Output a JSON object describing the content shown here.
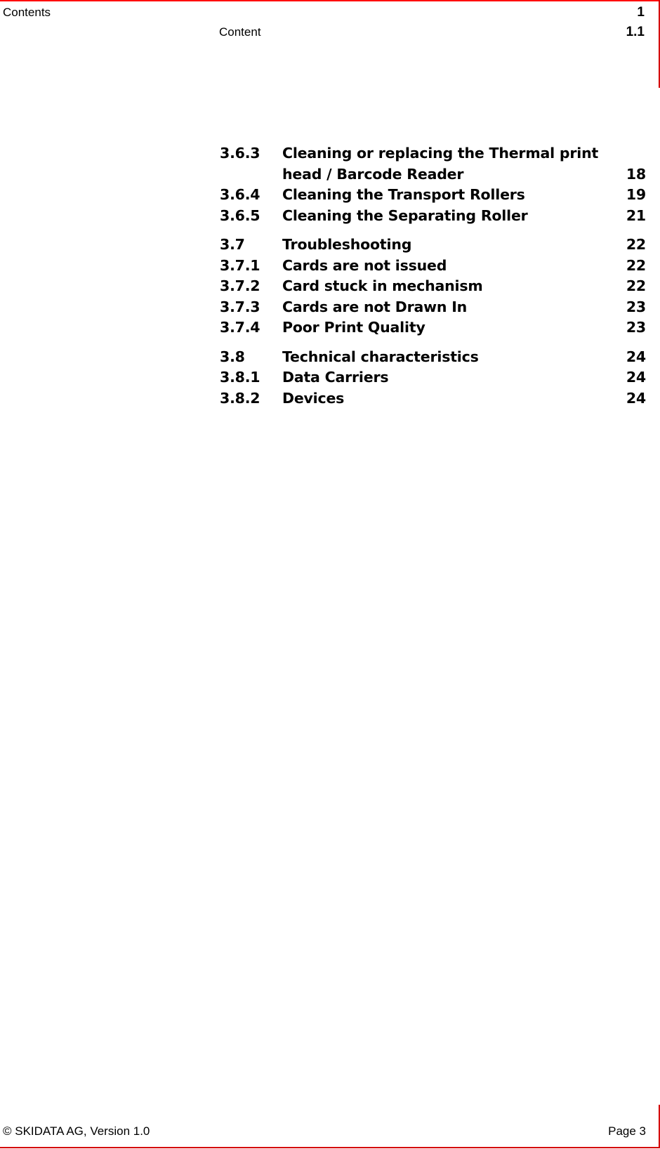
{
  "header": {
    "title": "Contents",
    "chapter_number": "1",
    "subtitle": "Content",
    "section_number": "1.1"
  },
  "toc": [
    {
      "number": "3.6.3",
      "title": "Cleaning or replacing the Thermal print",
      "page": ""
    },
    {
      "number": "",
      "title": "head / Barcode Reader",
      "page": "18"
    },
    {
      "number": "3.6.4",
      "title": "Cleaning the Transport Rollers",
      "page": "19"
    },
    {
      "number": "3.6.5",
      "title": "Cleaning the Separating Roller",
      "page": "21"
    },
    {
      "number": "3.7",
      "title": "Troubleshooting",
      "page": "22"
    },
    {
      "number": "3.7.1",
      "title": "Cards are not issued",
      "page": "22"
    },
    {
      "number": "3.7.2",
      "title": "Card stuck in mechanism",
      "page": "22"
    },
    {
      "number": "3.7.3",
      "title": "Cards are not Drawn In",
      "page": "23"
    },
    {
      "number": "3.7.4",
      "title": "Poor Print Quality",
      "page": "23"
    },
    {
      "number": "3.8",
      "title": "Technical characteristics",
      "page": "24"
    },
    {
      "number": "3.8.1",
      "title": "Data Carriers",
      "page": "24"
    },
    {
      "number": "3.8.2",
      "title": "Devices",
      "page": "24"
    }
  ],
  "footer": {
    "copyright": "© SKIDATA AG, Version 1.0",
    "page_label": "Page 3"
  },
  "colors": {
    "accent_rule": "#ff0000"
  }
}
